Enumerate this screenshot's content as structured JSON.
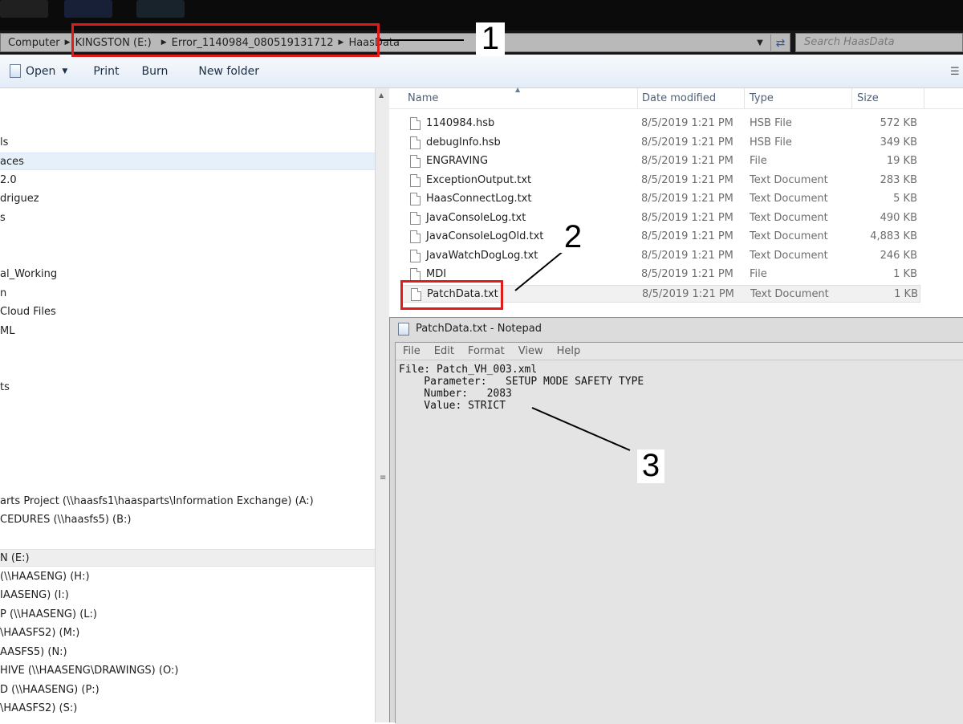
{
  "address_bar": {
    "crumbs": [
      "Computer",
      "KINGSTON (E:)",
      "Error_1140984_080519131712",
      "HaasData"
    ],
    "search_placeholder": "Search HaasData"
  },
  "toolbar": {
    "open": "Open",
    "print": "Print",
    "burn": "Burn",
    "new_folder": "New folder"
  },
  "nav": {
    "items": [
      "ls",
      "aces",
      "2.0",
      "driguez",
      "s",
      "al_Working",
      "n",
      "Cloud Files",
      "ML",
      "ts",
      "arts Project (\\\\haasfs1\\haasparts\\Information Exchange) (A:)",
      "CEDURES (\\\\haasfs5) (B:)",
      "N (E:)",
      "(\\\\HAASENG) (H:)",
      "IAASENG) (I:)",
      "P (\\\\HAASENG) (L:)",
      "\\HAASFS2) (M:)",
      "AASFS5) (N:)",
      "HIVE (\\\\HAASENG\\DRAWINGS) (O:)",
      "D (\\\\HAASENG) (P:)",
      "\\HAASFS2) (S:)"
    ]
  },
  "file_list": {
    "columns": [
      "Name",
      "Date modified",
      "Type",
      "Size"
    ],
    "rows": [
      {
        "name": "1140984.hsb",
        "date": "8/5/2019 1:21 PM",
        "type": "HSB File",
        "size": "572 KB"
      },
      {
        "name": "debugInfo.hsb",
        "date": "8/5/2019 1:21 PM",
        "type": "HSB File",
        "size": "349 KB"
      },
      {
        "name": "ENGRAVING",
        "date": "8/5/2019 1:21 PM",
        "type": "File",
        "size": "19 KB"
      },
      {
        "name": "ExceptionOutput.txt",
        "date": "8/5/2019 1:21 PM",
        "type": "Text Document",
        "size": "283 KB"
      },
      {
        "name": "HaasConnectLog.txt",
        "date": "8/5/2019 1:21 PM",
        "type": "Text Document",
        "size": "5 KB"
      },
      {
        "name": "JavaConsoleLog.txt",
        "date": "8/5/2019 1:21 PM",
        "type": "Text Document",
        "size": "490 KB"
      },
      {
        "name": "JavaConsoleLogOld.txt",
        "date": "8/5/2019 1:21 PM",
        "type": "Text Document",
        "size": "4,883 KB"
      },
      {
        "name": "JavaWatchDogLog.txt",
        "date": "8/5/2019 1:21 PM",
        "type": "Text Document",
        "size": "246 KB"
      },
      {
        "name": "MDI",
        "date": "8/5/2019 1:21 PM",
        "type": "File",
        "size": "1 KB"
      },
      {
        "name": "PatchData.txt",
        "date": "8/5/2019 1:21 PM",
        "type": "Text Document",
        "size": "1 KB"
      }
    ]
  },
  "notepad": {
    "title": "PatchData.txt - Notepad",
    "menu": [
      "File",
      "Edit",
      "Format",
      "View",
      "Help"
    ],
    "content": "File: Patch_VH_003.xml\n    Parameter:   SETUP MODE SAFETY TYPE\n    Number:   2083\n    Value: STRICT"
  },
  "annotations": {
    "callout_1": "1",
    "callout_2": "2",
    "callout_3": "3",
    "highlight_color": "#e01b1b"
  }
}
